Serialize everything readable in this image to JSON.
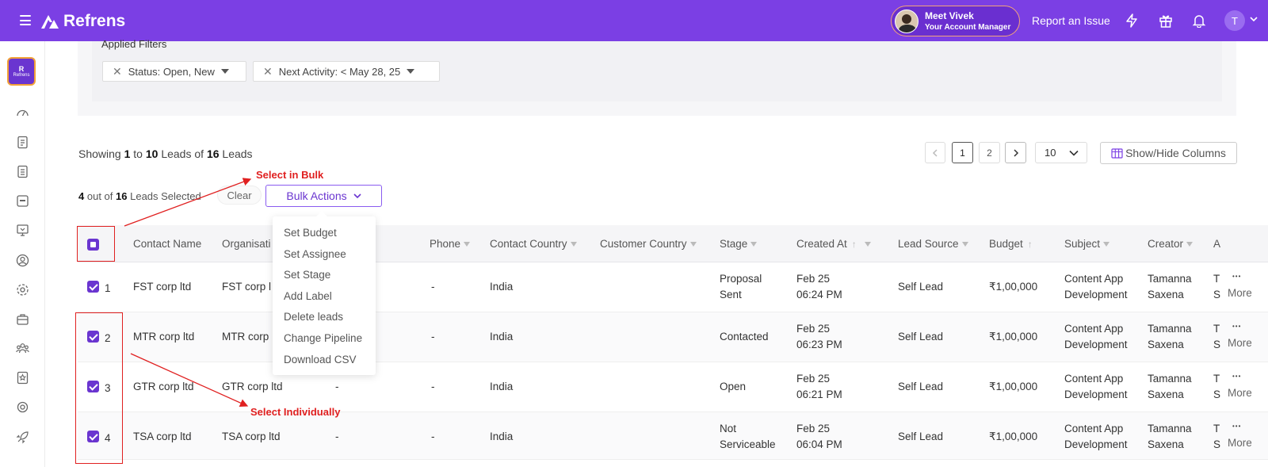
{
  "app": {
    "name": "Refrens",
    "brand_badge": "Refrens",
    "brand_badge_letter": "R"
  },
  "topbar": {
    "manager_name": "Meet Vivek",
    "manager_role": "Your Account Manager",
    "report_issue": "Report an Issue",
    "user_initial": "T",
    "icons": [
      "menu-icon",
      "bolt-icon",
      "gift-icon",
      "bell-icon",
      "chevron-down-icon"
    ]
  },
  "filters": {
    "title": "Applied Filters",
    "chips": [
      "Status: Open, New",
      "Next Activity: < May 28, 25"
    ]
  },
  "summary": {
    "showing": "Showing",
    "from": "1",
    "to_word": "to",
    "to": "10",
    "leads_of": "Leads of",
    "total": "16",
    "leads": "Leads"
  },
  "pagination": {
    "pages": [
      "1",
      "2"
    ],
    "current": "1",
    "page_size": "10"
  },
  "show_hide_columns": "Show/Hide Columns",
  "selection": {
    "count": "4",
    "out_of": "out of",
    "total": "16",
    "label": "Leads Selected",
    "clear": "Clear",
    "bulk_actions": "Bulk Actions"
  },
  "bulk_menu": [
    "Set Budget",
    "Set Assignee",
    "Set Stage",
    "Add Label",
    "Delete leads",
    "Change Pipeline",
    "Download CSV"
  ],
  "columns": {
    "contact_name": "Contact Name",
    "organisation": "Organisati",
    "phone": "Phone",
    "contact_country": "Contact Country",
    "customer_country": "Customer Country",
    "stage": "Stage",
    "created_at": "Created At",
    "lead_source": "Lead Source",
    "budget": "Budget",
    "subject": "Subject",
    "creator": "Creator",
    "assignee": "A"
  },
  "rows": [
    {
      "num": "1",
      "contact": "FST corp ltd",
      "org": "FST corp l",
      "col3": "",
      "phone": "-",
      "country": "India",
      "stage1": "Proposal",
      "stage2": "Sent",
      "created1": "Feb 25",
      "created2": "06:24 PM",
      "source": "Self Lead",
      "budget": "₹1,00,000",
      "subject1": "Content App",
      "subject2": "Development",
      "creator1": "Tamanna",
      "creator2": "Saxena",
      "assignee1": "T",
      "assignee2": "S",
      "more": "More"
    },
    {
      "num": "2",
      "contact": "MTR corp ltd",
      "org": "MTR corp",
      "col3": "",
      "phone": "-",
      "country": "India",
      "stage1": "Contacted",
      "stage2": "",
      "created1": "Feb 25",
      "created2": "06:23 PM",
      "source": "Self Lead",
      "budget": "₹1,00,000",
      "subject1": "Content App",
      "subject2": "Development",
      "creator1": "Tamanna",
      "creator2": "Saxena",
      "assignee1": "T",
      "assignee2": "S",
      "more": "More"
    },
    {
      "num": "3",
      "contact": "GTR corp ltd",
      "org": "GTR corp ltd",
      "col3": "-",
      "phone": "-",
      "country": "India",
      "stage1": "Open",
      "stage2": "",
      "created1": "Feb 25",
      "created2": "06:21 PM",
      "source": "Self Lead",
      "budget": "₹1,00,000",
      "subject1": "Content App",
      "subject2": "Development",
      "creator1": "Tamanna",
      "creator2": "Saxena",
      "assignee1": "T",
      "assignee2": "S",
      "more": "More"
    },
    {
      "num": "4",
      "contact": "TSA corp ltd",
      "org": "TSA corp ltd",
      "col3": "-",
      "phone": "-",
      "country": "India",
      "stage1": "Not",
      "stage2": "Serviceable",
      "created1": "Feb 25",
      "created2": "06:04 PM",
      "source": "Self Lead",
      "budget": "₹1,00,000",
      "subject1": "Content App",
      "subject2": "Development",
      "creator1": "Tamanna",
      "creator2": "Saxena",
      "assignee1": "T",
      "assignee2": "S",
      "more": "More"
    }
  ],
  "annotations": {
    "bulk": "Select in Bulk",
    "individual": "Select Individually"
  },
  "colors": {
    "brand": "#7b3fe4",
    "accent": "#6a35d0",
    "annotation": "#e02020"
  }
}
